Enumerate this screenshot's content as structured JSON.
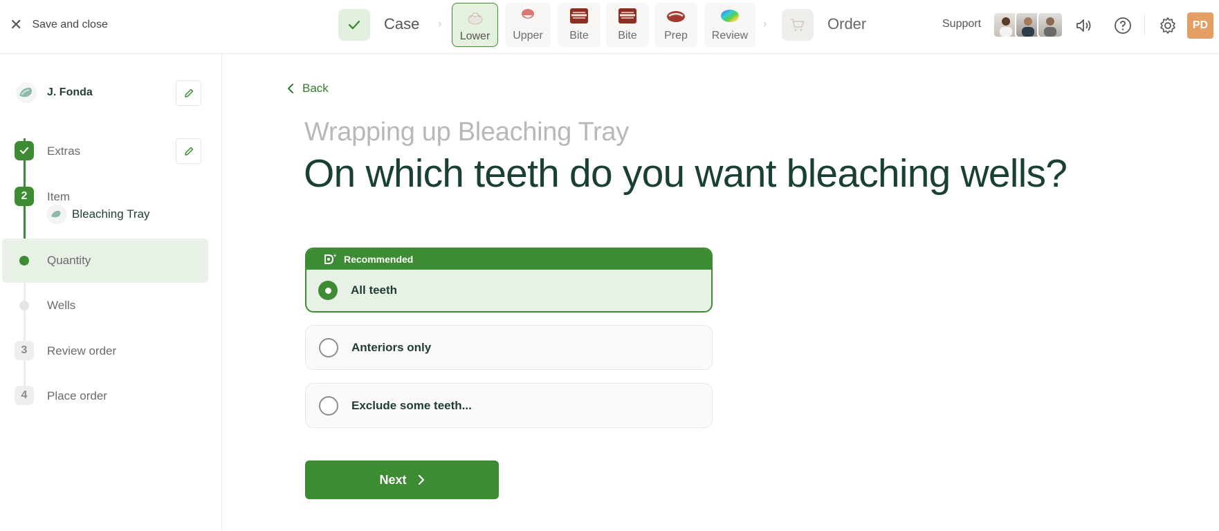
{
  "topbar": {
    "save_close": "Save and close",
    "case_label": "Case",
    "thumbs": [
      {
        "label": "Lower",
        "active": true
      },
      {
        "label": "Upper",
        "active": false
      },
      {
        "label": "Bite",
        "active": false
      },
      {
        "label": "Bite",
        "active": false
      },
      {
        "label": "Prep",
        "active": false
      },
      {
        "label": "Review",
        "active": false
      }
    ],
    "order_label": "Order",
    "support_label": "Support",
    "user_initials": "PD"
  },
  "sidebar": {
    "patient_name": "J. Fonda",
    "steps": [
      {
        "label": "Extras",
        "state": "done"
      },
      {
        "label": "Item",
        "number": "2",
        "state": "current",
        "sub_item": "Bleaching Tray"
      },
      {
        "label": "Quantity",
        "state": "active-substep"
      },
      {
        "label": "Wells",
        "state": "pending-substep"
      },
      {
        "label": "Review order",
        "number": "3",
        "state": "pending"
      },
      {
        "label": "Place order",
        "number": "4",
        "state": "pending"
      }
    ]
  },
  "main": {
    "back_label": "Back",
    "subtitle": "Wrapping up Bleaching Tray",
    "title": "On which teeth do you want bleaching wells?",
    "recommended_label": "Recommended",
    "options": [
      {
        "label": "All teeth",
        "selected": true,
        "recommended": true
      },
      {
        "label": "Anteriors only",
        "selected": false
      },
      {
        "label": "Exclude some teeth...",
        "selected": false
      }
    ],
    "next_label": "Next"
  },
  "colors": {
    "accent": "#3d8b32",
    "accent_light": "#e8f1e5",
    "title": "#1a4032",
    "avatar_bg": "#e4a064"
  }
}
